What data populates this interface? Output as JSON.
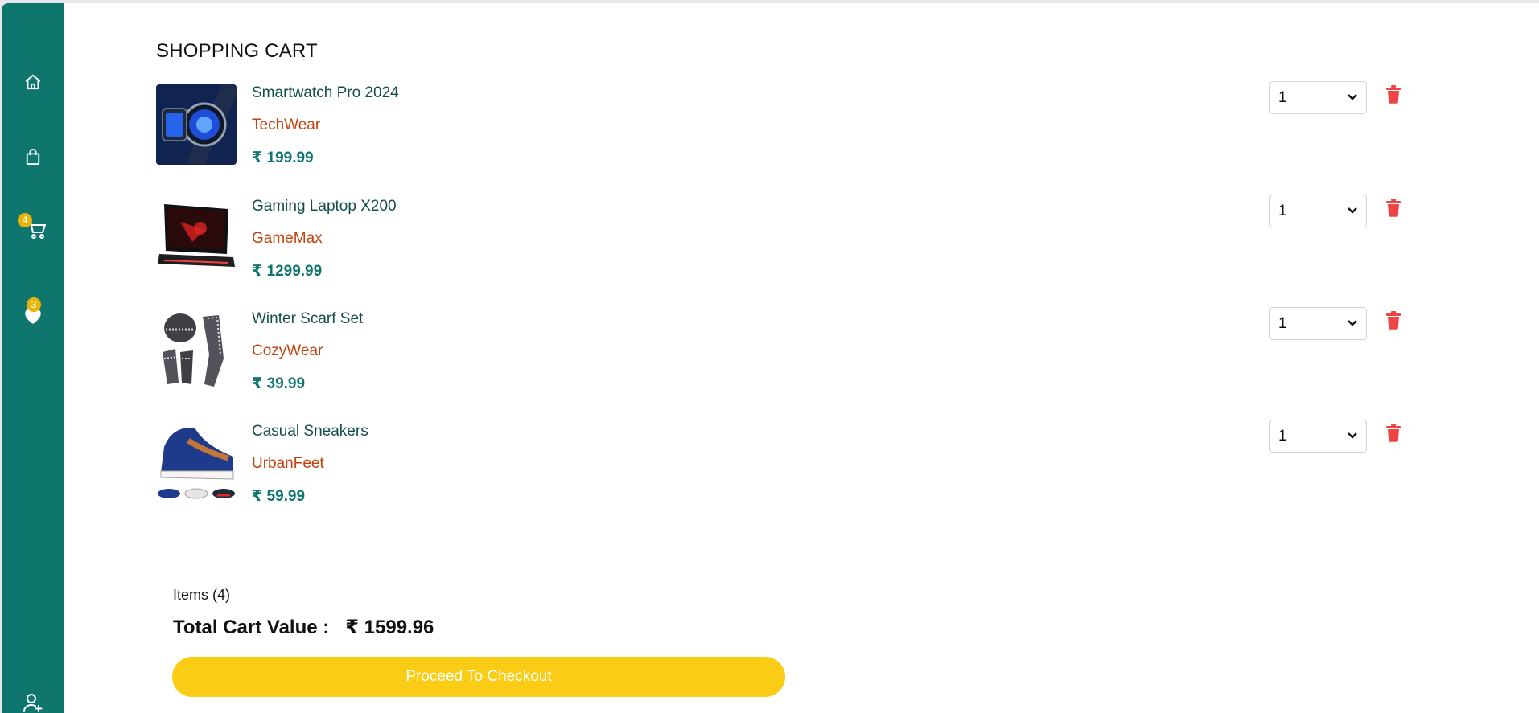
{
  "sidebar": {
    "items": [
      {
        "name": "home",
        "icon": "home-icon"
      },
      {
        "name": "shop",
        "icon": "shopping-bag-icon"
      },
      {
        "name": "cart",
        "icon": "cart-icon",
        "badge": "4"
      },
      {
        "name": "wishlist",
        "icon": "heart-icon",
        "badge": "3"
      },
      {
        "name": "account",
        "icon": "user-plus-icon"
      }
    ]
  },
  "page": {
    "title": "SHOPPING CART"
  },
  "cart": {
    "items": [
      {
        "name": "Smartwatch Pro 2024",
        "brand": "TechWear",
        "price": "₹ 199.99",
        "quantity": "1",
        "image": "smartwatch-image"
      },
      {
        "name": "Gaming Laptop X200",
        "brand": "GameMax",
        "price": "₹ 1299.99",
        "quantity": "1",
        "image": "laptop-image"
      },
      {
        "name": "Winter Scarf Set",
        "brand": "CozyWear",
        "price": "₹ 39.99",
        "quantity": "1",
        "image": "scarf-set-image"
      },
      {
        "name": "Casual Sneakers",
        "brand": "UrbanFeet",
        "price": "₹ 59.99",
        "quantity": "1",
        "image": "sneakers-image"
      }
    ]
  },
  "summary": {
    "items_label": "Items (4)",
    "total_label": "Total Cart Value :",
    "total_value": "₹ 1599.96",
    "checkout_label": "Proceed To Checkout"
  },
  "colors": {
    "sidebar": "#0f766e",
    "badge": "#eab308",
    "brand_text": "#c2410c",
    "price_text": "#0f766e",
    "delete_icon": "#ef4444",
    "checkout_button": "#facc15"
  }
}
